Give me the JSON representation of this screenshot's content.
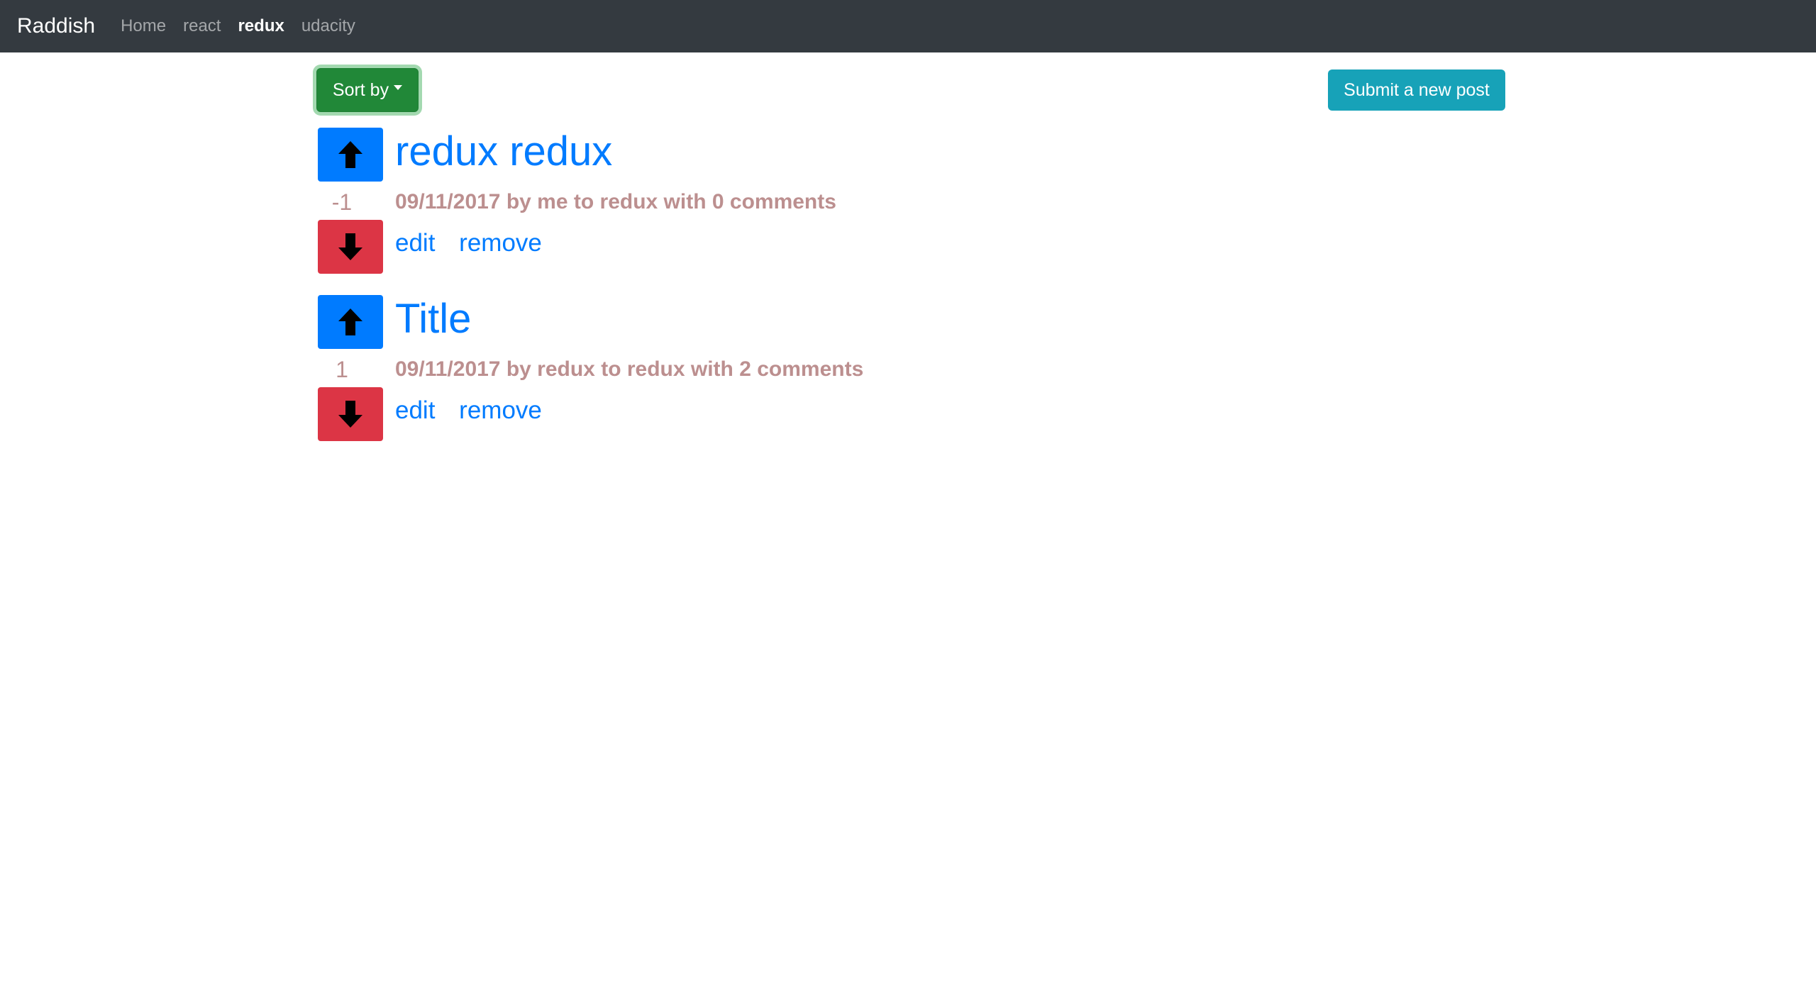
{
  "navbar": {
    "brand": "Raddish",
    "links": [
      {
        "label": "Home",
        "active": false
      },
      {
        "label": "react",
        "active": false
      },
      {
        "label": "redux",
        "active": true
      },
      {
        "label": "udacity",
        "active": false
      }
    ]
  },
  "toolbar": {
    "sort_label": "Sort by",
    "submit_label": "Submit a new post"
  },
  "posts": [
    {
      "title": "redux redux",
      "score": "-1",
      "meta": "09/11/2017 by me to redux with 0 comments",
      "edit_label": "edit",
      "remove_label": "remove"
    },
    {
      "title": "Title",
      "score": "1",
      "meta": "09/11/2017 by redux to redux with 2 comments",
      "edit_label": "edit",
      "remove_label": "remove"
    }
  ],
  "colors": {
    "navbar_bg": "#343a40",
    "primary": "#007bff",
    "danger": "#dc3545",
    "success": "#28a745",
    "info": "#17a2b8",
    "muted_rose": "#bc8f8f"
  },
  "icons": {
    "upvote": "arrow-up-icon",
    "downvote": "arrow-down-icon"
  }
}
